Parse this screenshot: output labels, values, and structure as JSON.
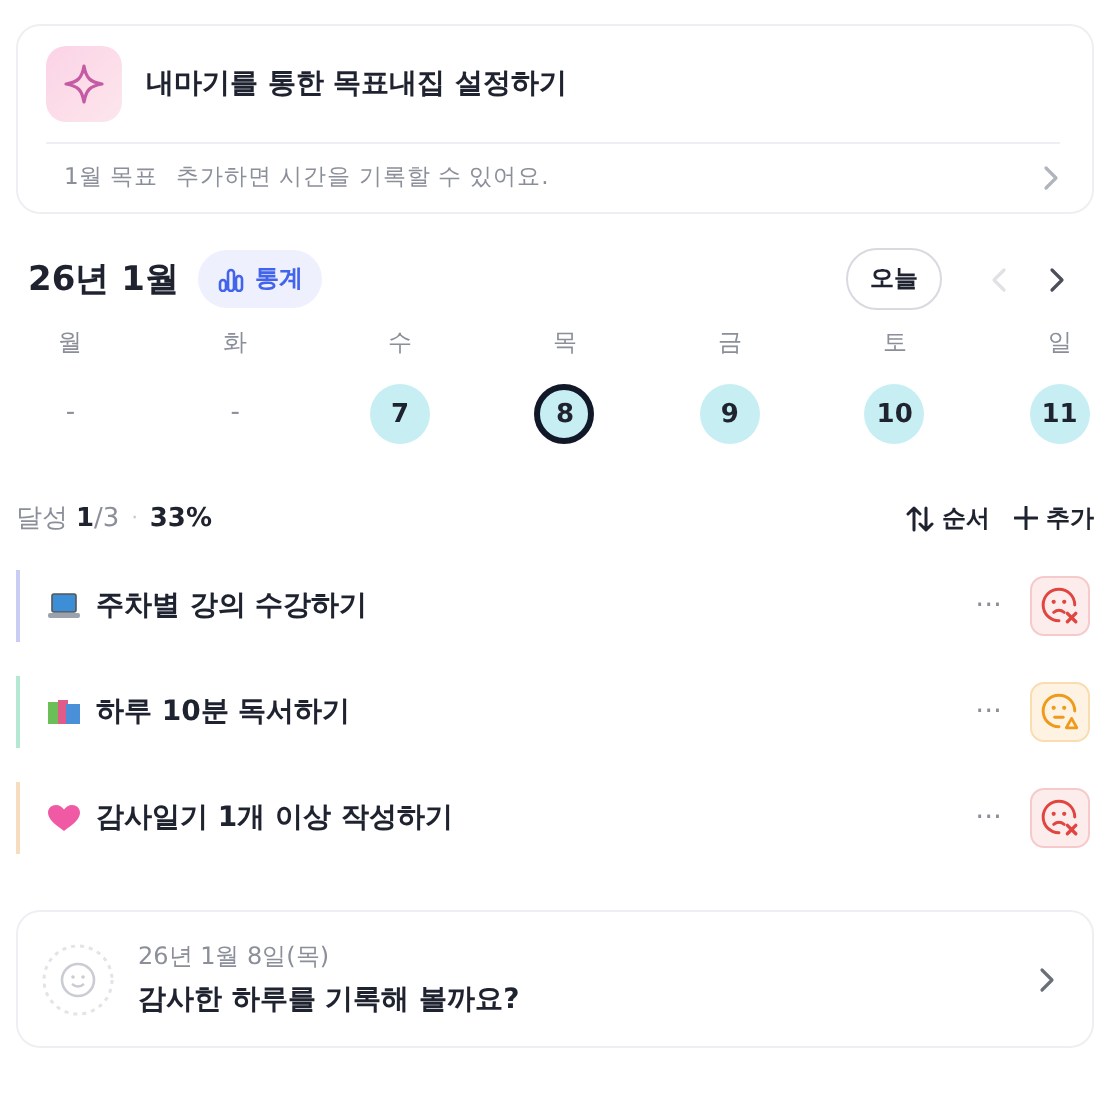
{
  "banner": {
    "title": "내마기를 통한 목표내집 설정하기",
    "goal_label": "1월 목표",
    "hint": "추가하면 시간을 기록할 수 있어요."
  },
  "header": {
    "month": "26년 1월",
    "stats_button": "통계",
    "today_button": "오늘",
    "prev": {
      "disabled": true
    },
    "next": {
      "disabled": false
    }
  },
  "week": [
    {
      "weekday": "월",
      "kind": "empty",
      "date": "-",
      "selected": false
    },
    {
      "weekday": "화",
      "kind": "empty",
      "date": "-",
      "selected": false
    },
    {
      "weekday": "수",
      "kind": "day",
      "date": "7",
      "selected": false
    },
    {
      "weekday": "목",
      "kind": "day",
      "date": "8",
      "selected": true
    },
    {
      "weekday": "금",
      "kind": "day",
      "date": "9",
      "selected": false
    },
    {
      "weekday": "토",
      "kind": "day",
      "date": "10",
      "selected": false
    },
    {
      "weekday": "일",
      "kind": "day",
      "date": "11",
      "selected": false
    }
  ],
  "summary": {
    "label": "달성",
    "done": "1",
    "total": "/3",
    "separator": "·",
    "percent": "33%",
    "sort_button": "순서",
    "add_button": "추가"
  },
  "goals": [
    {
      "kind": "laptop",
      "title": "주차별 강의 수강하기",
      "color": "#c9cdf3",
      "more": "···",
      "status": {
        "kind": "missed"
      }
    },
    {
      "kind": "books",
      "title": "하루 10분 독서하기",
      "color": "#b5e8d2",
      "more": "···",
      "status": {
        "kind": "partial"
      }
    },
    {
      "kind": "heart",
      "title": "감사일기 1개 이상 작성하기",
      "color": "#f8dcc0",
      "more": "···",
      "status": {
        "kind": "missed"
      }
    }
  ],
  "journal": {
    "date": "26년 1월 8일(목)",
    "prompt": "감사한 하루를 기록해 볼까요?"
  }
}
